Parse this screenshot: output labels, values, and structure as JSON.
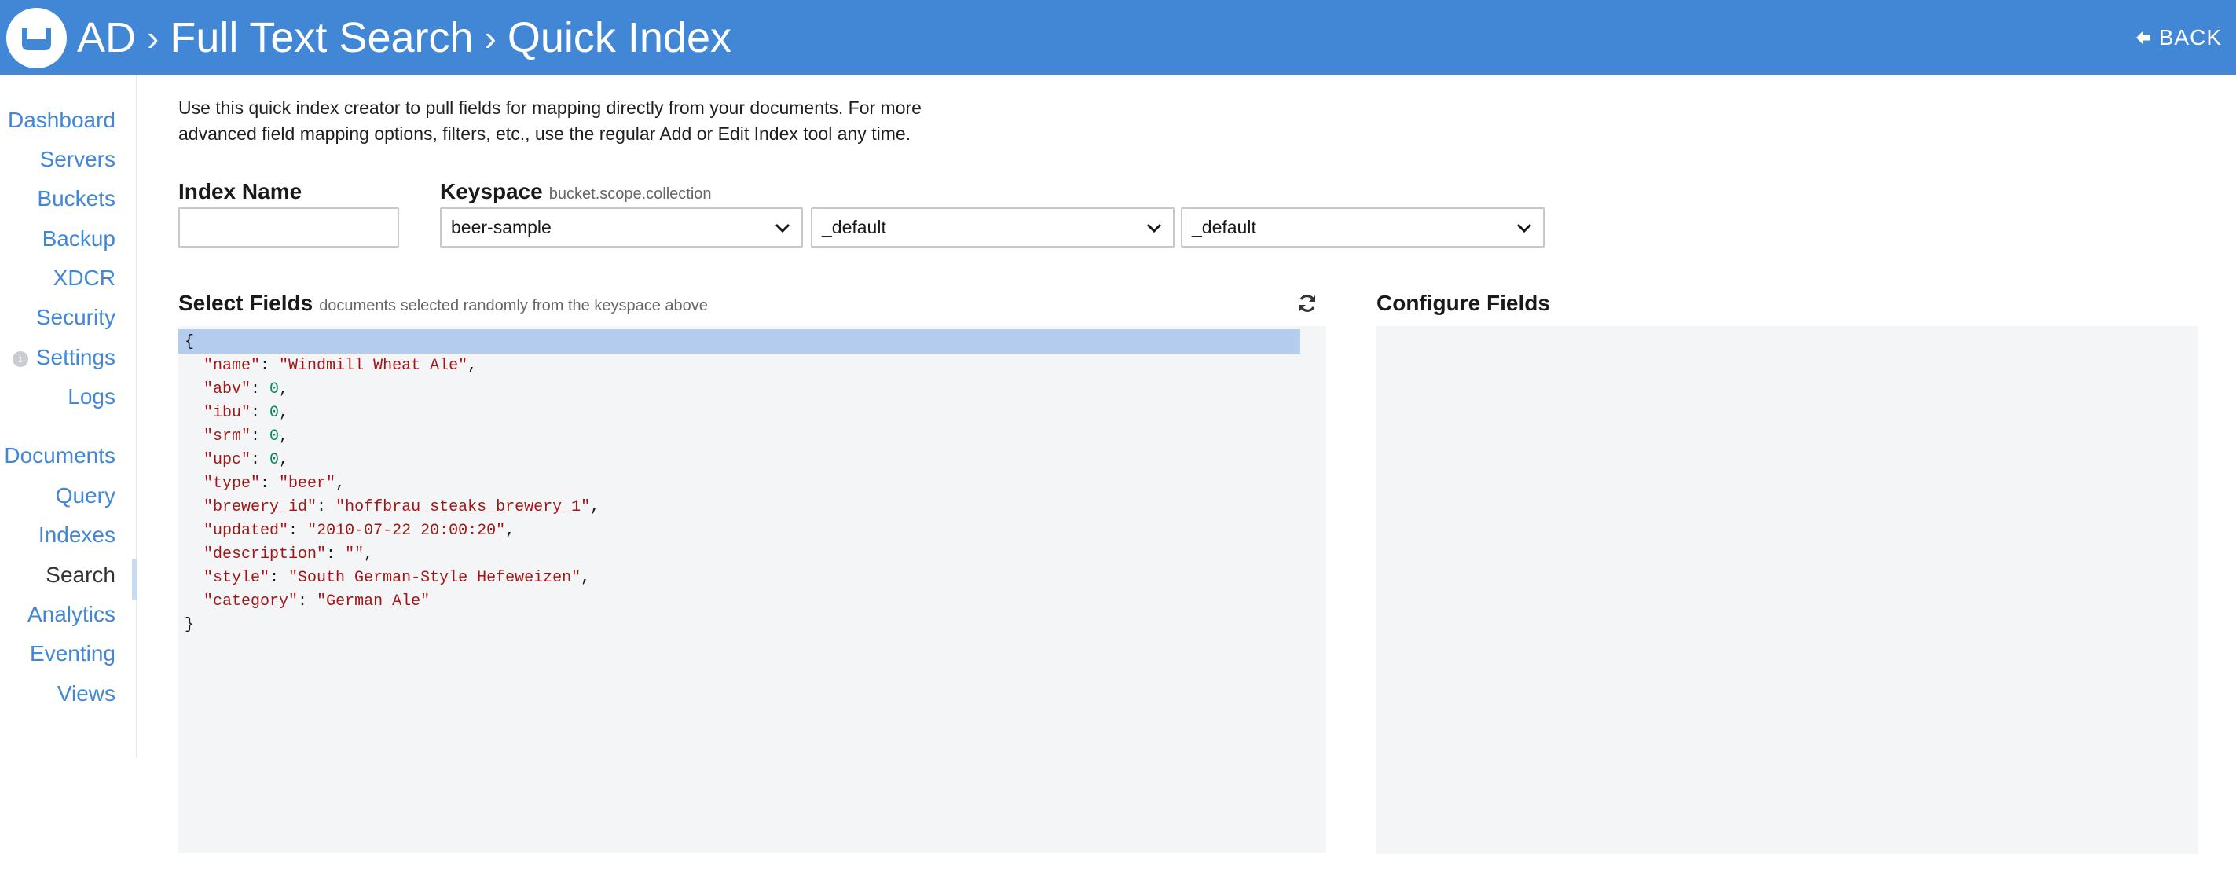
{
  "header": {
    "breadcrumbs": [
      "AD",
      "Full Text Search",
      "Quick Index"
    ],
    "back_label": "BACK",
    "logo_icon": "couchbase-logo-icon"
  },
  "sidebar": {
    "group1": [
      {
        "label": "Dashboard"
      },
      {
        "label": "Servers"
      },
      {
        "label": "Buckets"
      },
      {
        "label": "Backup"
      },
      {
        "label": "XDCR"
      },
      {
        "label": "Security"
      },
      {
        "label": "Settings",
        "icon": "info-icon",
        "icon_glyph": "i"
      },
      {
        "label": "Logs"
      }
    ],
    "group2": [
      {
        "label": "Documents"
      },
      {
        "label": "Query"
      },
      {
        "label": "Indexes"
      },
      {
        "label": "Search",
        "active": true
      },
      {
        "label": "Analytics"
      },
      {
        "label": "Eventing"
      },
      {
        "label": "Views"
      }
    ]
  },
  "main": {
    "intro_line1": "Use this quick index creator to pull fields for mapping directly from your documents. For more",
    "intro_line2": "advanced field mapping options, filters, etc., use the regular Add or Edit Index tool any time.",
    "index_name": {
      "label": "Index Name",
      "value": ""
    },
    "keyspace": {
      "label": "Keyspace",
      "hint": "bucket.scope.collection",
      "bucket": "beer-sample",
      "scope": "_default",
      "collection": "_default"
    },
    "select_fields": {
      "label": "Select Fields",
      "hint": "documents selected randomly from the keyspace above",
      "refresh_icon": "refresh-icon"
    },
    "configure_fields": {
      "label": "Configure Fields"
    }
  },
  "document": {
    "open_brace": "{",
    "close_brace": "}",
    "fields": [
      {
        "key": "\"name\"",
        "value": "\"Windmill Wheat Ale\"",
        "kind": "str",
        "comma": ","
      },
      {
        "key": "\"abv\"",
        "value": "0",
        "kind": "num",
        "comma": ","
      },
      {
        "key": "\"ibu\"",
        "value": "0",
        "kind": "num",
        "comma": ","
      },
      {
        "key": "\"srm\"",
        "value": "0",
        "kind": "num",
        "comma": ","
      },
      {
        "key": "\"upc\"",
        "value": "0",
        "kind": "num",
        "comma": ","
      },
      {
        "key": "\"type\"",
        "value": "\"beer\"",
        "kind": "str",
        "comma": ","
      },
      {
        "key": "\"brewery_id\"",
        "value": "\"hoffbrau_steaks_brewery_1\"",
        "kind": "str",
        "comma": ","
      },
      {
        "key": "\"updated\"",
        "value": "\"2010-07-22 20:00:20\"",
        "kind": "str",
        "comma": ","
      },
      {
        "key": "\"description\"",
        "value": "\"\"",
        "kind": "str",
        "comma": ","
      },
      {
        "key": "\"style\"",
        "value": "\"South German-Style Hefeweizen\"",
        "kind": "str",
        "comma": ","
      },
      {
        "key": "\"category\"",
        "value": "\"German Ale\"",
        "kind": "str",
        "comma": ""
      }
    ]
  },
  "colors": {
    "brand": "#4287d6",
    "panel_bg": "#f4f5f7",
    "highlight": "#b4cdee",
    "json_string": "#a31515",
    "json_number": "#09885a"
  }
}
